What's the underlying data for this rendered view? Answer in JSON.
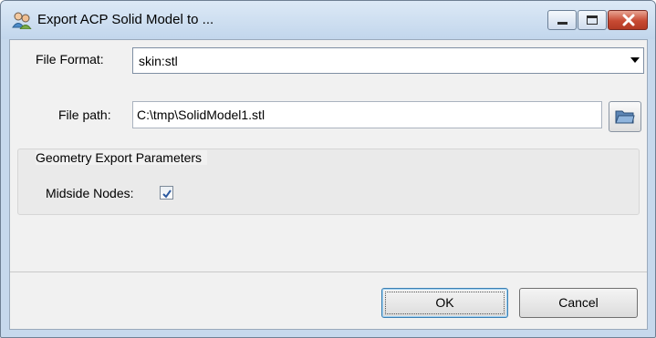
{
  "window": {
    "title": "Export ACP Solid Model to ..."
  },
  "form": {
    "file_format_label": "File Format:",
    "file_format_value": "skin:stl",
    "file_path_label": "File path:",
    "file_path_value": "C:\\tmp\\SolidModel1.stl"
  },
  "group": {
    "title": "Geometry Export Parameters",
    "midside_nodes_label": "Midside Nodes:",
    "midside_nodes_checked": true
  },
  "buttons": {
    "ok_label": "OK",
    "cancel_label": "Cancel"
  },
  "icons": {
    "app": "users-icon",
    "browse": "folder-icon",
    "minimize": "minimize-icon",
    "maximize": "maximize-icon",
    "close": "close-icon"
  },
  "colors": {
    "titlebar": "#c6d8ec",
    "close_button": "#c74a33",
    "dialog_background": "#f1f1f1",
    "check_mark": "#2c5aa0"
  }
}
